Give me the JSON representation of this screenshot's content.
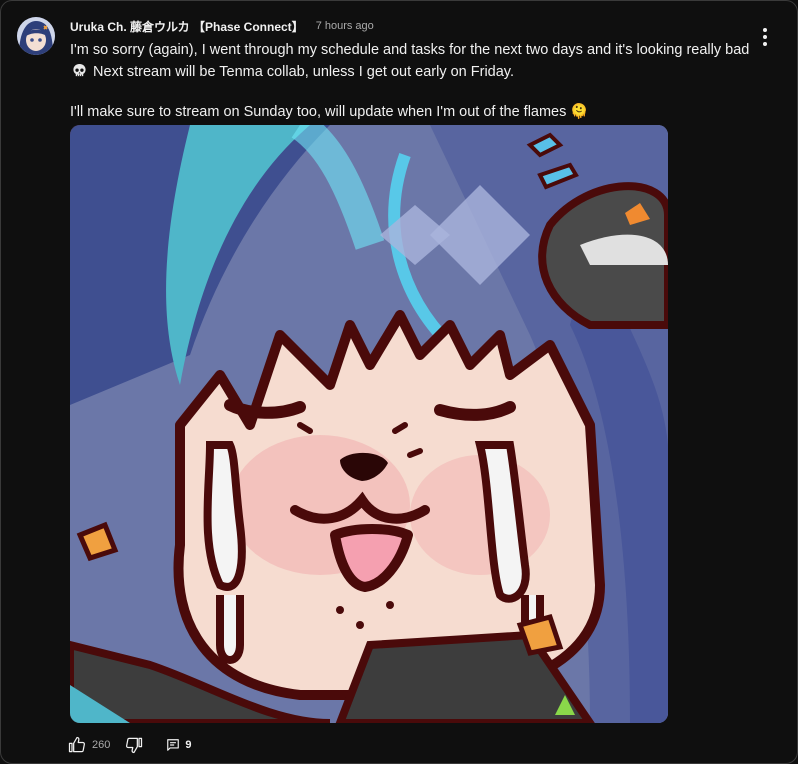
{
  "post": {
    "author": "Uruka Ch. 藤倉ウルカ 【Phase Connect】",
    "time": "7 hours ago",
    "paragraph1_a": "I'm so sorry (again), I went through my schedule and tasks for the next two days and it's looking really bad",
    "paragraph1_b": "Next stream will be Tenma collab, unless I get out early on Friday.",
    "paragraph2": "I'll make sure to stream on Sunday too, will update when I'm out of the flames 🫠",
    "emoji_icon": "skull-icon"
  },
  "actions": {
    "like_count": "260",
    "reply_count": "9",
    "like_icon": "thumbs-up-icon",
    "dislike_icon": "thumbs-down-icon",
    "reply_icon": "comment-icon"
  },
  "colors": {
    "background": "#0f0f0f",
    "text": "#f1f1f1",
    "muted": "#aaaaaa",
    "image_bg": "#6b77a8",
    "hair_blue": "#4a5a9a",
    "outline": "#4a0a0a",
    "skin": "#f6dcd0"
  }
}
